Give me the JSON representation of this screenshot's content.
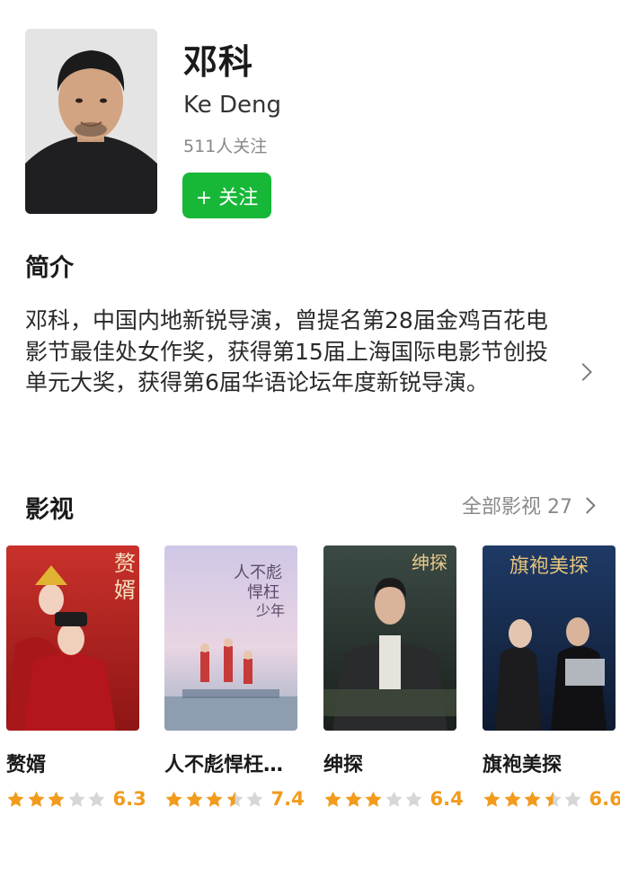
{
  "profile": {
    "name": "邓科",
    "english_name": "Ke Deng",
    "followers": "511人关注",
    "follow_label": "+ 关注"
  },
  "intro": {
    "title": "简介",
    "text": "邓科，中国内地新锐导演，曾提名第28届金鸡百花电影节最佳处女作奖，获得第15届上海国际电影节创投单元大奖，获得第6届华语论坛年度新锐导演。"
  },
  "films_section": {
    "title": "影视",
    "all_label": "全部影视 27"
  },
  "films": [
    {
      "title": "赘婿",
      "score": "6.3",
      "stars": 3,
      "poster_text": "赘婿"
    },
    {
      "title": "人不彪悍枉…",
      "score": "7.4",
      "stars": 3.5,
      "poster_text": "人不彪悍枉少年"
    },
    {
      "title": "绅探",
      "score": "6.4",
      "stars": 3,
      "poster_text": "绅探"
    },
    {
      "title": "旗袍美探",
      "score": "6.6",
      "stars": 3.5,
      "poster_text": "旗袍美探"
    }
  ],
  "colors": {
    "follow_button": "#17b838",
    "star_filled": "#f29b1c",
    "star_empty": "#d6d6d6"
  }
}
